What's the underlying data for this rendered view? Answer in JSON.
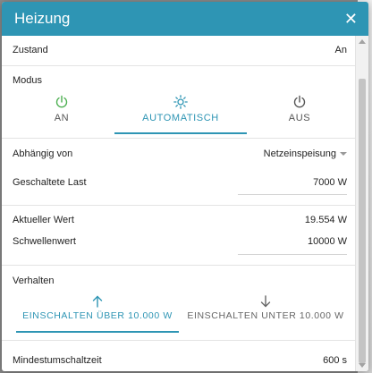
{
  "dialog": {
    "title": "Heizung"
  },
  "zustand": {
    "label": "Zustand",
    "value": "An"
  },
  "modus": {
    "label": "Modus",
    "options": [
      {
        "label": "AN",
        "icon": "power-icon",
        "color": "#4caf50"
      },
      {
        "label": "AUTOMATISCH",
        "icon": "sun-icon",
        "color": "#2e95b4",
        "selected": true
      },
      {
        "label": "AUS",
        "icon": "power-icon",
        "color": "#555555"
      }
    ]
  },
  "abhaengig": {
    "label": "Abhängig von",
    "value": "Netzeinspeisung"
  },
  "last": {
    "label": "Geschaltete Last",
    "value": "7000 W"
  },
  "aktuell": {
    "label": "Aktueller Wert",
    "value": "19.554 W"
  },
  "schwelle": {
    "label": "Schwellenwert",
    "value": "10000 W"
  },
  "verhalten": {
    "label": "Verhalten",
    "options": [
      {
        "label": "EINSCHALTEN ÜBER 10.000 W",
        "icon": "arrow-up-icon",
        "selected": true
      },
      {
        "label": "EINSCHALTEN UNTER 10.000 W",
        "icon": "arrow-down-icon"
      }
    ]
  },
  "mindest": {
    "label": "Mindestumschaltzeit",
    "value": "600 s"
  },
  "colors": {
    "accent": "#2e95b4",
    "on": "#4caf50"
  }
}
